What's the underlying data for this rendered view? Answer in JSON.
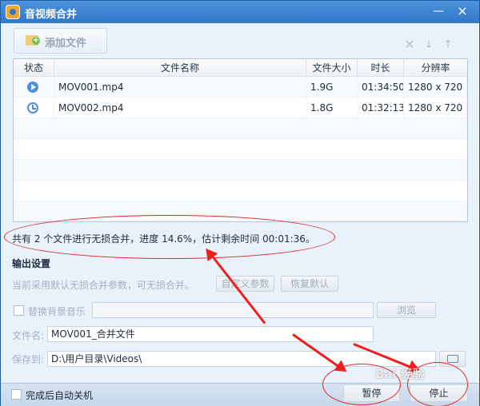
{
  "window": {
    "title": "音视频合并",
    "minimize_label": "—",
    "close_label": "×"
  },
  "toolbar": {
    "add_file_label": "添加文件",
    "icons": [
      "delete-icon",
      "move-down-icon",
      "move-up-icon"
    ],
    "delete_symbol": "✕",
    "down_symbol": "↓",
    "up_symbol": "↑"
  },
  "file_table": {
    "columns": [
      "状态",
      "文件名称",
      "文件大小",
      "时长",
      "分辨率"
    ],
    "rows": [
      {
        "status": "play-icon",
        "name": "MOV001.mp4",
        "size": "1.9G",
        "duration": "01:34:50",
        "resolution": "1280 x 720"
      },
      {
        "status": "clock-icon",
        "name": "MOV002.mp4",
        "size": "1.8G",
        "duration": "01:32:13",
        "resolution": "1280 x 720"
      }
    ]
  },
  "progress": {
    "text": "共有 2 个文件进行无损合并，进度 14.6%，估计剩余时间 00:01:36。"
  },
  "output_settings": {
    "section_title": "输出设置",
    "param_text": "当前采用默认无损合并参数，可无损合并。",
    "custom_param_button": "自定义参数",
    "restore_default_button": "恢复默认",
    "replace_music_label": "替换背景音乐",
    "browse_button": "浏览",
    "filename_label": "文件名:",
    "filename_value": "MOV001_合并文件",
    "save_to_label": "保存到:",
    "save_to_value": "D:\\用户目录\\Videos\\"
  },
  "footer": {
    "shutdown_label": "完成后自动关机",
    "pause_button": "暂停",
    "stop_button": "停止"
  },
  "annotations": {
    "watermark_text": "Bai 经验"
  },
  "colors": {
    "title_blue": "#2f77c8",
    "annotation_red": "#e02828"
  }
}
